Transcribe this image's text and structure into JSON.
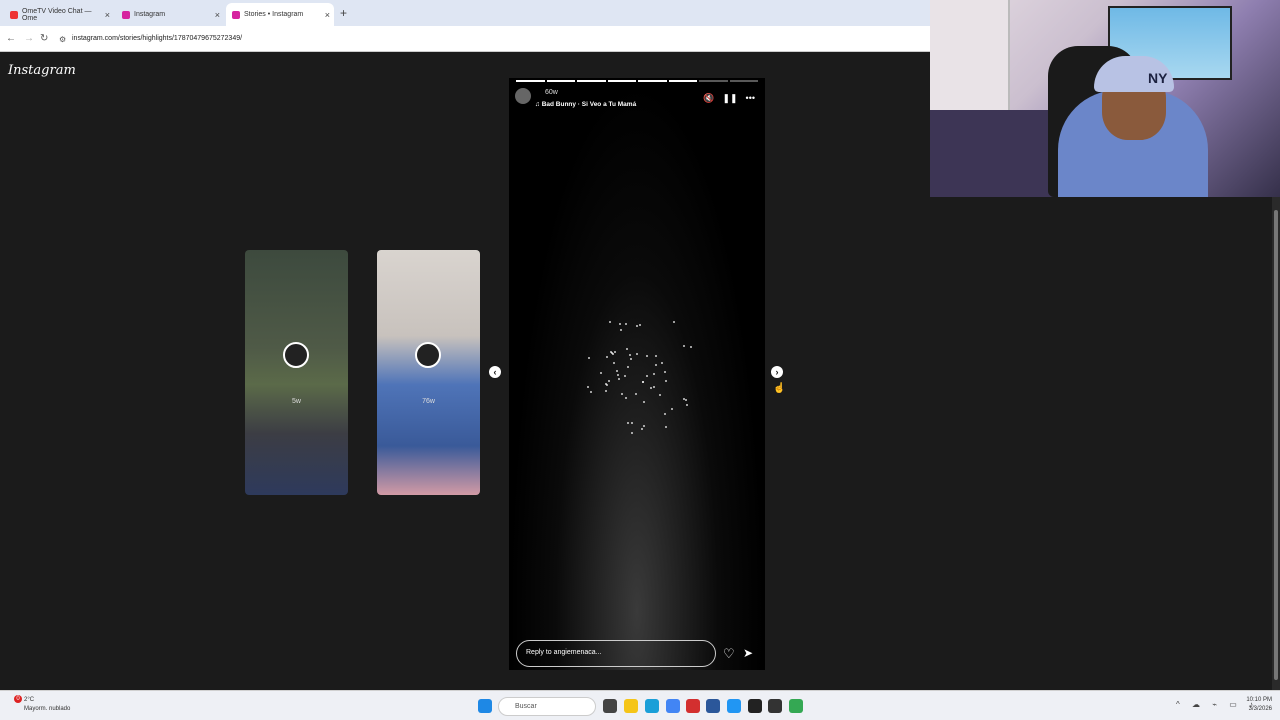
{
  "browser": {
    "tabs": [
      {
        "label": "OmeTV Video Chat — Ome",
        "active": false
      },
      {
        "label": "Instagram",
        "active": false
      },
      {
        "label": "Stories • Instagram",
        "active": true
      }
    ],
    "url": "instagram.com/stories/highlights/17870479675272349/"
  },
  "instagram": {
    "logo": "Instagram",
    "previews": [
      {
        "age": "5w"
      },
      {
        "age": "76w"
      }
    ],
    "story": {
      "progress_segments": 8,
      "active_segment": 6,
      "time_ago": "60w",
      "music": "Bad Bunny · Si Veo a Tu Mamá",
      "reply_placeholder": "Reply to angiemenaca..."
    }
  },
  "taskbar": {
    "weather_temp": "2°C",
    "weather_desc": "Mayorm. nublado",
    "notification_count": "0",
    "search_label": "Buscar",
    "time": "10:10 PM",
    "date": "3/3/2026"
  },
  "webcam": {
    "cap_logo": "NY"
  },
  "colors": {
    "story_bg": "#000000",
    "page_bg": "#1b1b1b",
    "tabbar_bg": "#dfe6f3"
  }
}
